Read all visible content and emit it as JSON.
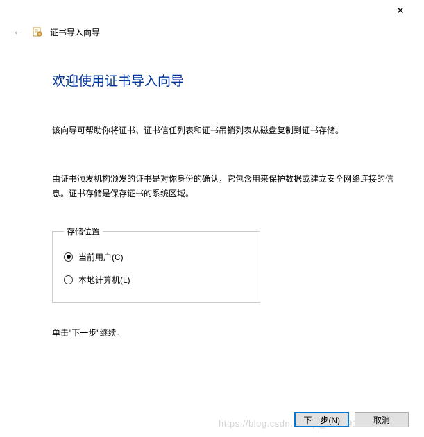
{
  "titlebar": {
    "close_glyph": "✕"
  },
  "header": {
    "back_glyph": "←",
    "title": "证书导入向导"
  },
  "main": {
    "heading": "欢迎使用证书导入向导",
    "paragraph1": "该向导可帮助你将证书、证书信任列表和证书吊销列表从磁盘复制到证书存储。",
    "paragraph2": "由证书颁发机构颁发的证书是对你身份的确认，它包含用来保护数据或建立安全网络连接的信息。证书存储是保存证书的系统区域。",
    "storage": {
      "legend": "存储位置",
      "options": [
        {
          "label": "当前用户(C)",
          "selected": true
        },
        {
          "label": "本地计算机(L)",
          "selected": false
        }
      ]
    },
    "continue_text": "单击\"下一步\"继续。"
  },
  "footer": {
    "next_label": "下一步(N)",
    "cancel_label": "取消"
  },
  "watermark": "https://blog.csdn.net/qq_37289140"
}
